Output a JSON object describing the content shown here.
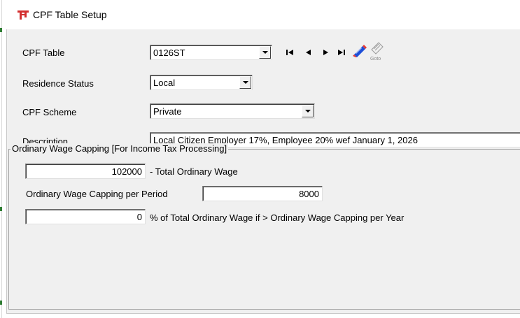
{
  "window": {
    "title": "CPF Table Setup"
  },
  "form": {
    "cpf_table": {
      "label": "CPF Table",
      "value": "0126ST"
    },
    "residence_status": {
      "label": "Residence Status",
      "value": "Local"
    },
    "cpf_scheme": {
      "label": "CPF Scheme",
      "value": "Private"
    },
    "description": {
      "label": "Description",
      "value": "Local Citizen Employer 17%, Employee 20% wef January 1, 2026"
    }
  },
  "navigation": {
    "first_icon": "first-record-icon",
    "prev_icon": "previous-record-icon",
    "next_icon": "next-record-icon",
    "last_icon": "last-record-icon",
    "edit_icon": "edit-pencil-icon",
    "goto_icon": "goto-icon",
    "goto_label": "Goto"
  },
  "ordinary_wage_capping": {
    "title": "Ordinary Wage Capping [For Income Tax Processing]",
    "total_ordinary_wage": {
      "value": "102000",
      "label": "- Total Ordinary Wage"
    },
    "capping_per_period": {
      "label": "Ordinary Wage Capping per Period",
      "value": "8000"
    },
    "percent_of_total": {
      "value": "0",
      "label": "% of Total Ordinary Wage if > Ordinary Wage Capping per Year"
    }
  },
  "colors": {
    "panel_bg": "#f0f0f0",
    "title_icon": "#d32f2f",
    "edit_icon_blue": "#1e4fd8",
    "edit_icon_red": "#e53935"
  }
}
